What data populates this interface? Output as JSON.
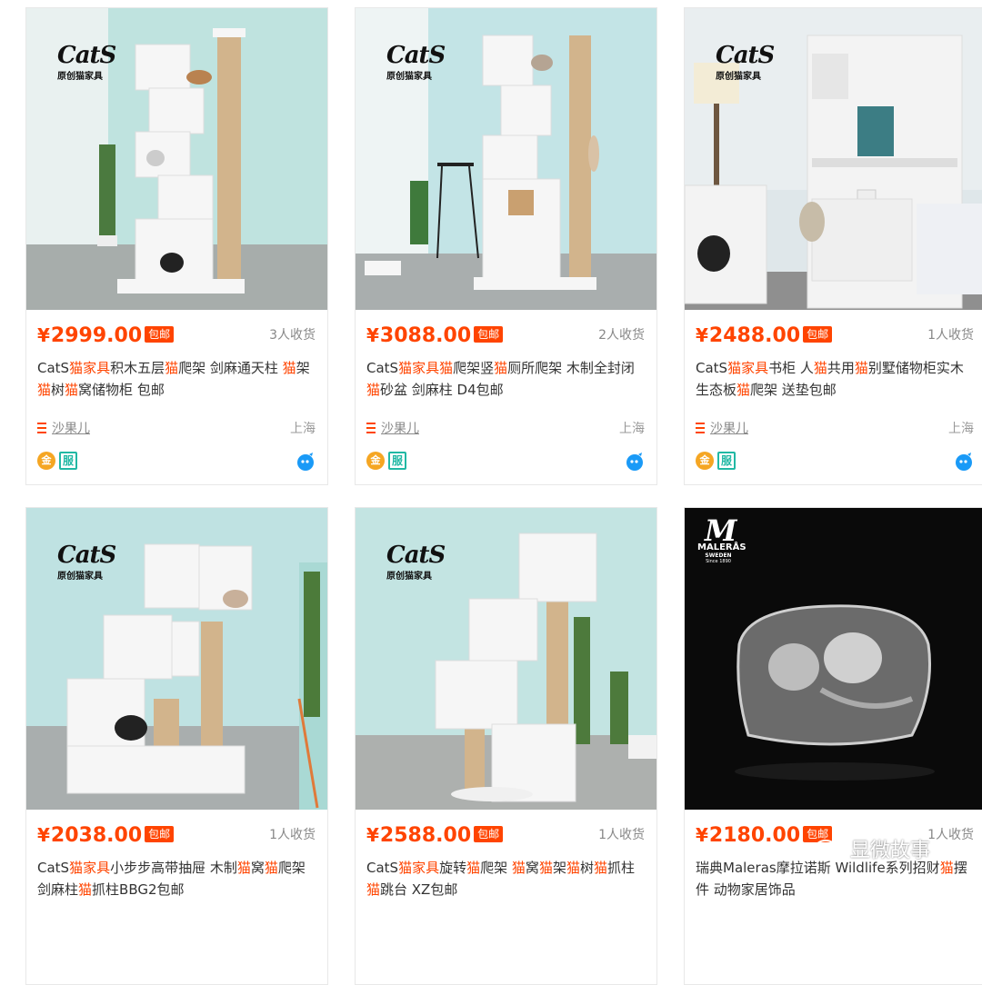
{
  "products": [
    {
      "logo_brand": "CatS",
      "logo_sub": "原创猫家具",
      "currency": "¥",
      "price": "2999.00",
      "tag": "包邮",
      "sales": "3人收货",
      "title_parts": [
        {
          "text": "CatS",
          "kw": false
        },
        {
          "text": "猫家具",
          "kw": true
        },
        {
          "text": "积木五层",
          "kw": false
        },
        {
          "text": "猫",
          "kw": true
        },
        {
          "text": "爬架 剑麻通天柱 ",
          "kw": false
        },
        {
          "text": "猫",
          "kw": true
        },
        {
          "text": "架",
          "kw": false
        },
        {
          "text": "猫",
          "kw": true
        },
        {
          "text": "树",
          "kw": false
        },
        {
          "text": "猫",
          "kw": true
        },
        {
          "text": "窝储物柜 包邮",
          "kw": false
        }
      ],
      "shop": "沙果儿",
      "location": "上海",
      "badge_gold": "金",
      "badge_fw": "服"
    },
    {
      "logo_brand": "CatS",
      "logo_sub": "原创猫家具",
      "currency": "¥",
      "price": "3088.00",
      "tag": "包邮",
      "sales": "2人收货",
      "title_parts": [
        {
          "text": "CatS",
          "kw": false
        },
        {
          "text": "猫家具猫",
          "kw": true
        },
        {
          "text": "爬架竖",
          "kw": false
        },
        {
          "text": "猫",
          "kw": true
        },
        {
          "text": "厕所爬架 木制全封闭",
          "kw": false
        },
        {
          "text": "猫",
          "kw": true
        },
        {
          "text": "砂盆 剑麻柱 D4包邮",
          "kw": false
        }
      ],
      "shop": "沙果儿",
      "location": "上海",
      "badge_gold": "金",
      "badge_fw": "服"
    },
    {
      "logo_brand": "CatS",
      "logo_sub": "原创猫家具",
      "currency": "¥",
      "price": "2488.00",
      "tag": "包邮",
      "sales": "1人收货",
      "title_parts": [
        {
          "text": "CatS",
          "kw": false
        },
        {
          "text": "猫家具",
          "kw": true
        },
        {
          "text": "书柜 人",
          "kw": false
        },
        {
          "text": "猫",
          "kw": true
        },
        {
          "text": "共用",
          "kw": false
        },
        {
          "text": "猫",
          "kw": true
        },
        {
          "text": "别墅储物柜实木生态板",
          "kw": false
        },
        {
          "text": "猫",
          "kw": true
        },
        {
          "text": "爬架 送垫包邮",
          "kw": false
        }
      ],
      "shop": "沙果儿",
      "location": "上海",
      "badge_gold": "金",
      "badge_fw": "服"
    },
    {
      "logo_brand": "CatS",
      "logo_sub": "原创猫家具",
      "currency": "¥",
      "price": "2038.00",
      "tag": "包邮",
      "sales": "1人收货",
      "title_parts": [
        {
          "text": "CatS",
          "kw": false
        },
        {
          "text": "猫家具",
          "kw": true
        },
        {
          "text": "小步步高带抽屉 木制",
          "kw": false
        },
        {
          "text": "猫",
          "kw": true
        },
        {
          "text": "窝",
          "kw": false
        },
        {
          "text": "猫",
          "kw": true
        },
        {
          "text": "爬架 剑麻柱",
          "kw": false
        },
        {
          "text": "猫",
          "kw": true
        },
        {
          "text": "抓柱BBG2包邮",
          "kw": false
        }
      ]
    },
    {
      "logo_brand": "CatS",
      "logo_sub": "原创猫家具",
      "currency": "¥",
      "price": "2588.00",
      "tag": "包邮",
      "sales": "1人收货",
      "title_parts": [
        {
          "text": "CatS",
          "kw": false
        },
        {
          "text": "猫家具",
          "kw": true
        },
        {
          "text": "旋转",
          "kw": false
        },
        {
          "text": "猫",
          "kw": true
        },
        {
          "text": "爬架 ",
          "kw": false
        },
        {
          "text": "猫",
          "kw": true
        },
        {
          "text": "窝",
          "kw": false
        },
        {
          "text": "猫",
          "kw": true
        },
        {
          "text": "架",
          "kw": false
        },
        {
          "text": "猫",
          "kw": true
        },
        {
          "text": "树",
          "kw": false
        },
        {
          "text": "猫",
          "kw": true
        },
        {
          "text": "抓柱",
          "kw": false
        },
        {
          "text": "猫",
          "kw": true
        },
        {
          "text": "跳台 XZ包邮",
          "kw": false
        }
      ]
    },
    {
      "logo_brand": "MALERÅS",
      "logo_sub": "SWEDEN",
      "logo_since": "Since 1890",
      "currency": "¥",
      "price": "2180.00",
      "tag": "包邮",
      "sales": "1人收货",
      "title_parts": [
        {
          "text": "瑞典Maleras摩拉诺斯 Wildlife系列招财",
          "kw": false
        },
        {
          "text": "猫",
          "kw": true
        },
        {
          "text": "摆件 动物家居饰品",
          "kw": false
        }
      ]
    }
  ],
  "watermark": "显微故事",
  "colors": {
    "accent": "#ff4400",
    "badge_teal": "#21b8a4",
    "badge_gold": "#f5a623"
  }
}
